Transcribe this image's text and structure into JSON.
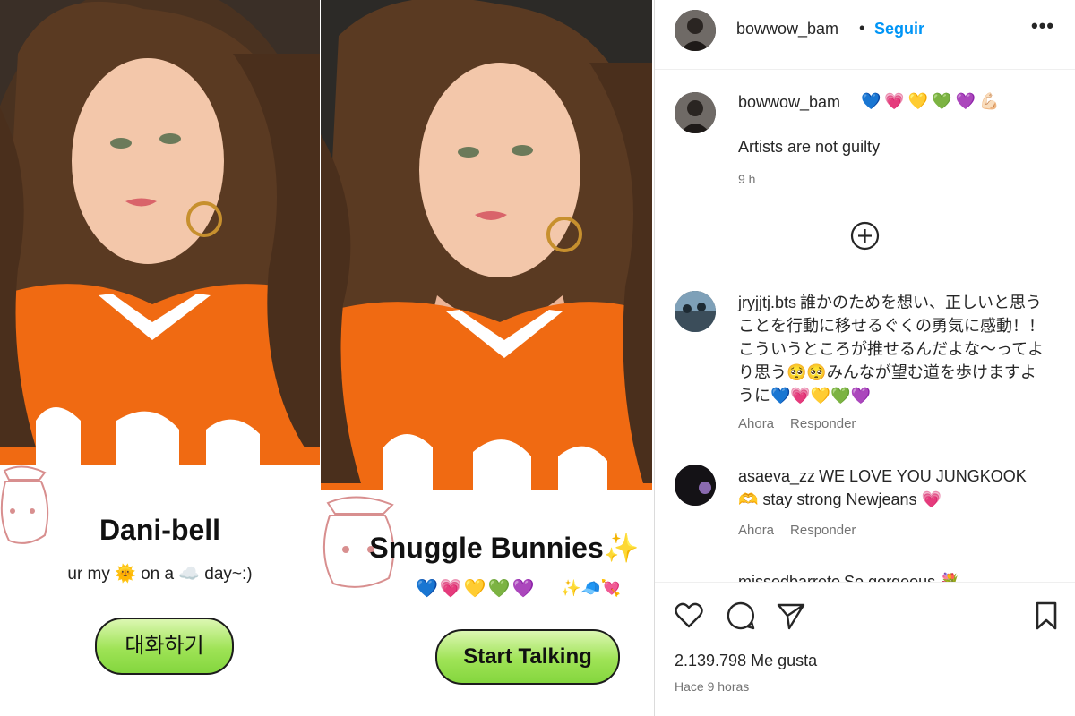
{
  "card_left": {
    "name": "Dani-bell",
    "tagline": "ur my 🌞 on a ☁️ day~:)",
    "cta_label": "대화하기"
  },
  "card_right": {
    "name": "Snuggle Bunnies✨",
    "emoji_hearts": "💙💗💛💚💜",
    "emoji_extra": "✨🧢💘",
    "cta_label": "Start Talking"
  },
  "instagram": {
    "header": {
      "username": "bowwow_bam",
      "separator": "•",
      "follow_label": "Seguir",
      "more_label": "•••"
    },
    "caption": {
      "username": "bowwow_bam",
      "emoji": "💙💗💛💚💜💪🏻",
      "text": "Artists are not guilty",
      "time": "9 h"
    },
    "comments": [
      {
        "username": "jryjjtj.bts",
        "text": "誰かのためを想い、正しいと思うことを行動に移せるぐくの勇気に感動！！ こういうところが推せるんだよな〜ってより思う🥺🥺みんなが望む道を歩けますように💙💗💛💚💜",
        "time": "Ahora",
        "reply_label": "Responder"
      },
      {
        "username": "asaeva_zz",
        "text": "WE LOVE YOU JUNGKOOK 🫶 stay strong Newjeans 💗",
        "time": "Ahora",
        "reply_label": "Responder"
      },
      {
        "username": "missedbarreto",
        "text": "So gorgeous 💐",
        "time": "",
        "reply_label": ""
      }
    ],
    "likes": "2.139.798 Me gusta",
    "post_time": "Hace 9 horas"
  },
  "icons": [
    "add-comments-icon",
    "heart-icon",
    "comment-icon",
    "share-icon",
    "bookmark-icon",
    "more-icon"
  ],
  "colors": {
    "follow": "#0095f6",
    "button_green": "#9fe356",
    "shirt_orange": "#f06a12"
  }
}
